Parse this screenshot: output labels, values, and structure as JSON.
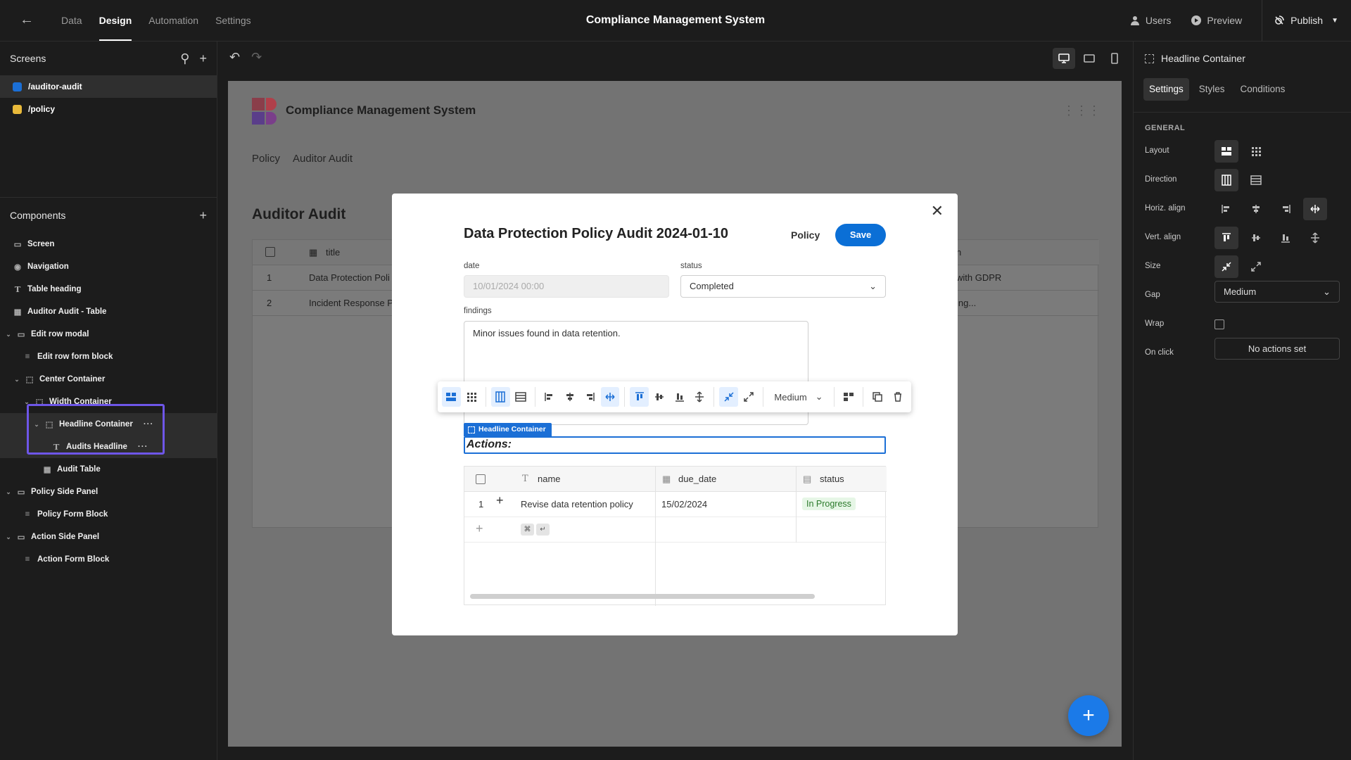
{
  "topbar": {
    "nav_tabs": [
      "Data",
      "Design",
      "Automation",
      "Settings"
    ],
    "active_tab": "Design",
    "app_title": "Compliance Management System",
    "users_label": "Users",
    "preview_label": "Preview",
    "publish_label": "Publish"
  },
  "left": {
    "screens_title": "Screens",
    "screens": [
      {
        "label": "/auditor-audit",
        "color": "#1b6fd6"
      },
      {
        "label": "/policy",
        "color": "#e8b93a"
      }
    ],
    "components_title": "Components",
    "components": [
      {
        "label": "Screen",
        "icon": "screen-icon"
      },
      {
        "label": "Navigation",
        "icon": "eye-icon"
      },
      {
        "label": "Table heading",
        "icon": "text-icon"
      },
      {
        "label": "Auditor Audit - Table",
        "icon": "table-icon"
      },
      {
        "label": "Edit row modal",
        "icon": "modal-icon"
      },
      {
        "label": "Edit row form block",
        "icon": "form-icon"
      },
      {
        "label": "Center Container",
        "icon": "container-icon"
      },
      {
        "label": "Width Container",
        "icon": "container-icon"
      },
      {
        "label": "Headline Container",
        "icon": "container-icon"
      },
      {
        "label": "Audits Headline",
        "icon": "text-icon"
      },
      {
        "label": "Audit Table",
        "icon": "table-icon"
      },
      {
        "label": "Policy Side Panel",
        "icon": "panel-icon"
      },
      {
        "label": "Policy Form Block",
        "icon": "form-icon"
      },
      {
        "label": "Action Side Panel",
        "icon": "panel-icon"
      },
      {
        "label": "Action Form Block",
        "icon": "form-icon"
      }
    ]
  },
  "canvas": {
    "app_name": "Compliance Management System",
    "nav": [
      "Policy",
      "Auditor Audit"
    ],
    "page_title": "Auditor Audit",
    "table_header": "title",
    "rows": [
      {
        "num": "1",
        "title": "Data Protection Poli",
        "tail": "with GDPR"
      },
      {
        "num": "2",
        "title": "Incident Response P",
        "tail": "ing..."
      }
    ],
    "tail_header": "n"
  },
  "modal": {
    "title": "Data Protection Policy Audit 2024-01-10",
    "policy_link": "Policy",
    "save_label": "Save",
    "date_label": "date",
    "date_value": "10/01/2024 00:00",
    "status_label": "status",
    "status_value": "Completed",
    "findings_label": "findings",
    "findings_value": "Minor issues found in data retention.",
    "toolbar_size": "Medium",
    "headline_tag": "Headline Container",
    "actions_heading": "Actions:",
    "table": {
      "columns": [
        "name",
        "due_date",
        "status"
      ],
      "rows": [
        {
          "num": "1",
          "name": "Revise data retention policy",
          "due_date": "15/02/2024",
          "status": "In Progress"
        }
      ],
      "shortcut": [
        "⌘",
        "↵"
      ]
    }
  },
  "right": {
    "title": "Headline Container",
    "tabs": [
      "Settings",
      "Styles",
      "Conditions"
    ],
    "active_tab": "Settings",
    "section": "GENERAL",
    "layout_label": "Layout",
    "direction_label": "Direction",
    "horiz_label": "Horiz. align",
    "vert_label": "Vert. align",
    "size_label": "Size",
    "gap_label": "Gap",
    "gap_value": "Medium",
    "wrap_label": "Wrap",
    "onclick_label": "On click",
    "onclick_value": "No actions set"
  }
}
